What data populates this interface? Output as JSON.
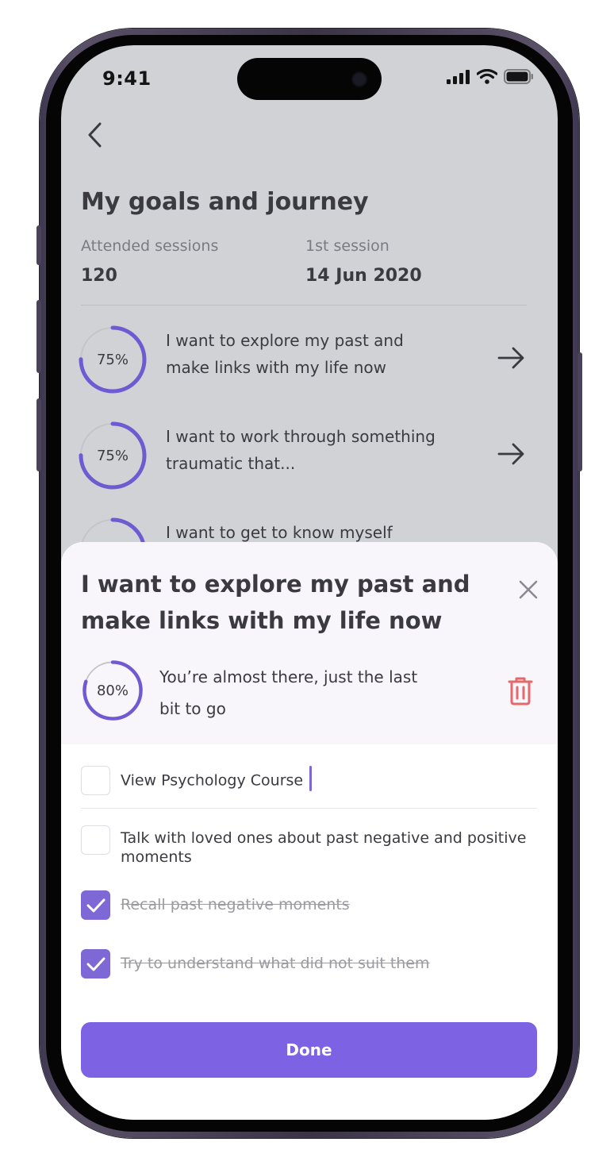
{
  "status_bar": {
    "time": "9:41"
  },
  "page": {
    "title": "My goals and journey",
    "stats": [
      {
        "label": "Attended sessions",
        "value": "120"
      },
      {
        "label": "1st session",
        "value": "14 Jun 2020"
      }
    ],
    "goals": [
      {
        "percent_label": "75%",
        "progress": 0.75,
        "text": "I want to explore my past and make links with my life now"
      },
      {
        "percent_label": "75%",
        "progress": 0.75,
        "text": "I want to work through something traumatic that..."
      },
      {
        "percent_label": "",
        "progress": 0.25,
        "text": "I want to get to know myself better"
      }
    ]
  },
  "sheet": {
    "title": "I want to explore my past and make links with my life now",
    "progress_label": "80%",
    "progress": 0.8,
    "progress_text": "You’re almost there, just the last bit to go",
    "tasks": [
      {
        "text": "View Psychology Course",
        "checked": false
      },
      {
        "text": "Talk with loved ones about past negative and positive moments",
        "checked": false
      },
      {
        "text": "Recall past negative moments",
        "checked": true
      },
      {
        "text": "Try to understand what did not suit them",
        "checked": true
      }
    ],
    "done_label": "Done"
  },
  "colors": {
    "accent": "#7d62e3",
    "ring": "#6f5bd1",
    "danger": "#e36a6a"
  }
}
